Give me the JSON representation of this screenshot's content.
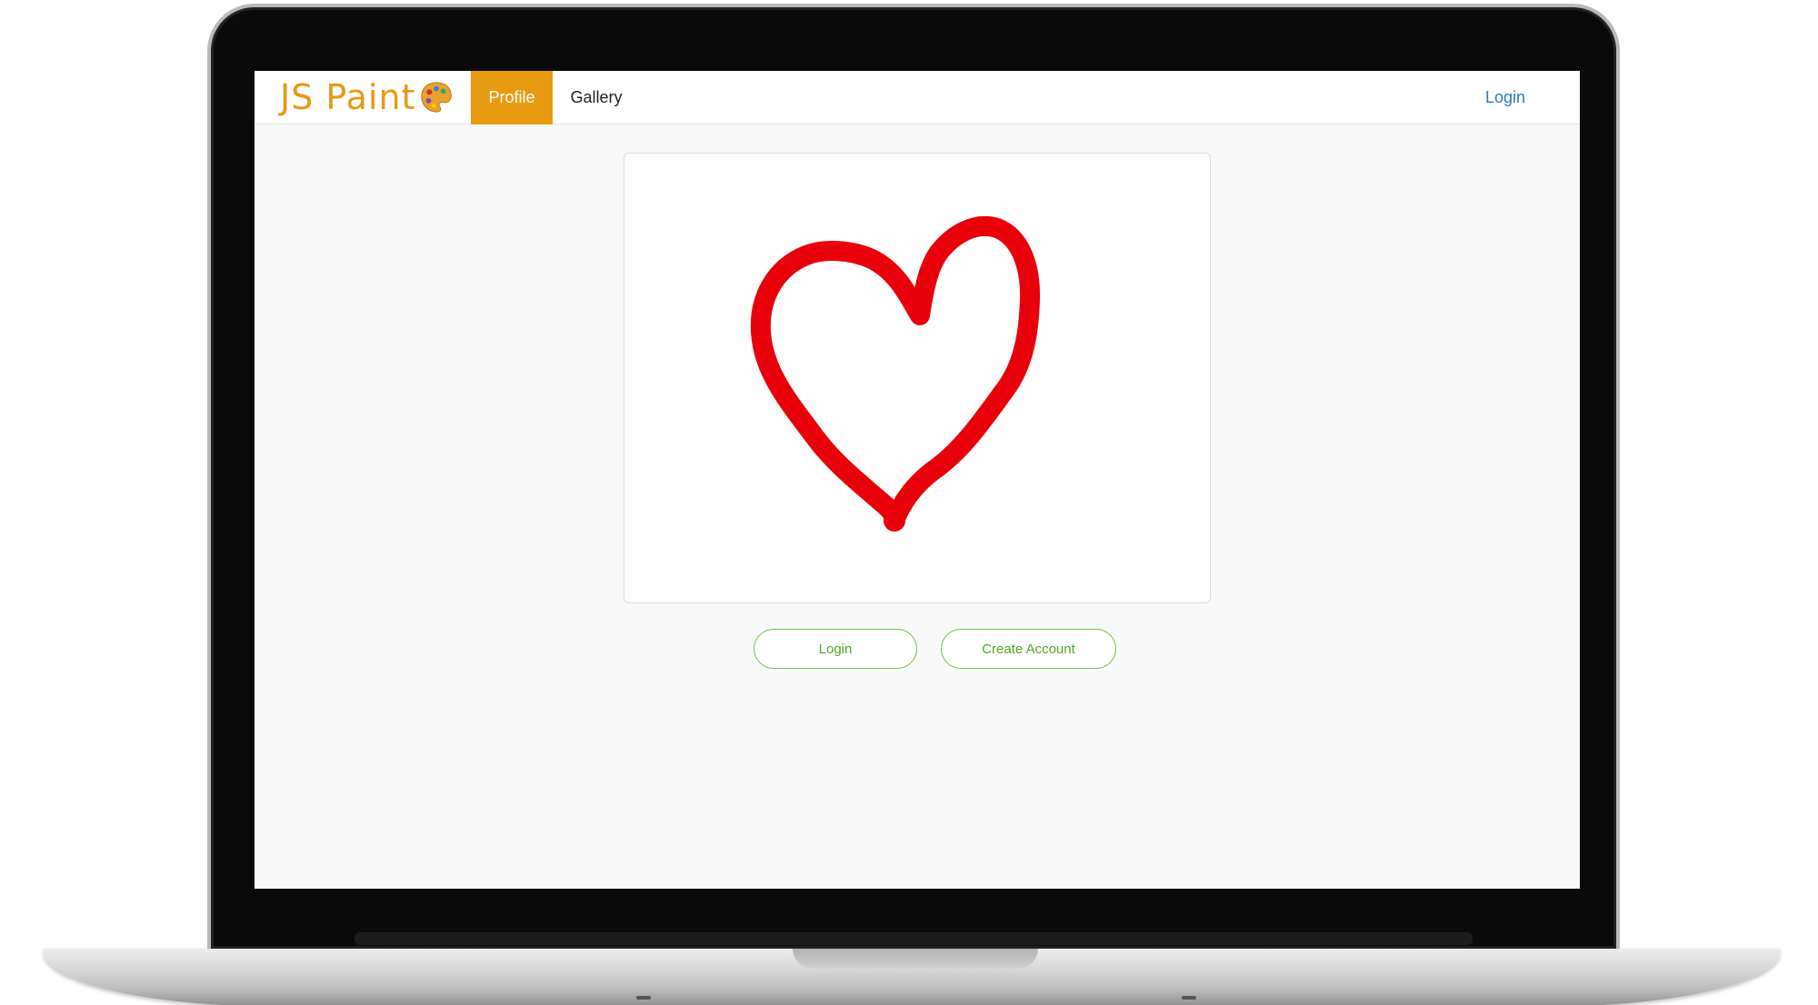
{
  "navbar": {
    "brand": "JS Paint",
    "tabs": [
      {
        "label": "Profile",
        "active": true
      },
      {
        "label": "Gallery",
        "active": false
      }
    ],
    "login_link": "Login"
  },
  "canvas": {
    "drawing": "heart-icon",
    "stroke_color": "#e8000b"
  },
  "actions": {
    "login_button": "Login",
    "create_account_button": "Create Account"
  },
  "colors": {
    "brand": "#e59a16",
    "active_tab": "#e89a10",
    "link": "#2a7ab8",
    "button_border": "#6cc04a",
    "button_text": "#4aa824"
  }
}
